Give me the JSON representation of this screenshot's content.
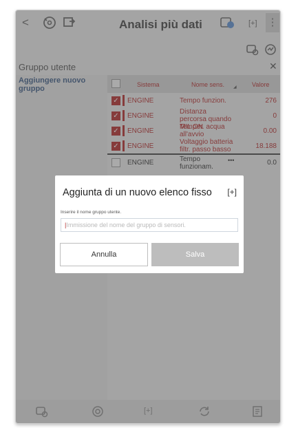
{
  "topbar": {
    "back_icon": "<",
    "title": "Analisi più dati",
    "expand_icon": "[+]",
    "more_icon": "⋮"
  },
  "group": {
    "header": "Gruppo utente",
    "close_icon": "✕",
    "add_item": "Aggiungere nuovo gruppo"
  },
  "table": {
    "headers": [
      "Sistema",
      "Nome sens.",
      "Valore"
    ],
    "rows": [
      {
        "checked": true,
        "system": "ENGINE",
        "name": "Tempo funzion.",
        "value": "276"
      },
      {
        "checked": true,
        "system": "ENGINE",
        "name": "Distanza percorsa quando MIL ON",
        "value": "0"
      },
      {
        "checked": true,
        "system": "ENGINE",
        "name": "Temper. acqua all'avvio",
        "value": "0.00"
      },
      {
        "checked": true,
        "system": "ENGINE",
        "name": "Voltaggio batteria filtr. passo basso",
        "value": "18.188"
      },
      {
        "checked": false,
        "system": "ENGINE",
        "name": "Tempo funzionam.",
        "value": "0.0",
        "more": "•••"
      }
    ]
  },
  "dialog": {
    "title": "Aggiunta di un nuovo elenco fisso",
    "expand_icon": "[+]",
    "label": "Inserire il nome gruppo utente.",
    "placeholder": "Immissione del nome del gruppo di sensori.",
    "cancel": "Annulla",
    "save": "Salva"
  },
  "colors": {
    "accent": "#b32b2b",
    "header_bg": "#d3d3d3",
    "link": "#3d5c86"
  }
}
